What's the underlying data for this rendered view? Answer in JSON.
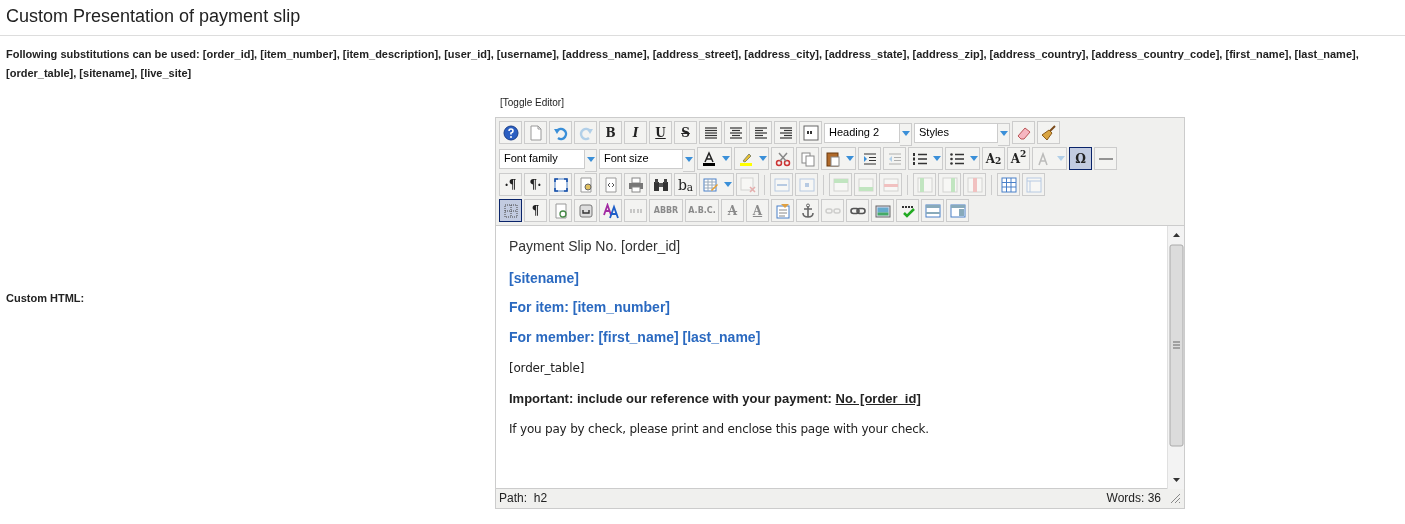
{
  "page_title": "Custom Presentation of payment slip",
  "substitutions": "Following substitutions can be used: [order_id], [item_number], [item_description], [user_id], [username], [address_name], [address_street], [address_city], [address_state], [address_zip], [address_country], [address_country_code], [first_name], [last_name], [order_table], [sitename], [live_site]",
  "field_label": "Custom HTML:",
  "toggle_editor": "[Toggle Editor]",
  "toolbar_rows": [
    [
      {
        "kind": "button",
        "disabled": false,
        "on": false
      },
      {
        "kind": "button",
        "disabled": false,
        "on": false
      },
      {
        "kind": "button",
        "disabled": false,
        "on": false
      },
      {
        "kind": "button",
        "disabled": true,
        "on": false
      },
      {
        "kind": "text",
        "label": "B",
        "disabled": false,
        "on": false
      },
      {
        "kind": "text",
        "label": "I",
        "disabled": false,
        "on": false
      },
      {
        "kind": "text",
        "label": "U",
        "disabled": false,
        "on": false
      },
      {
        "kind": "text",
        "label": "S",
        "disabled": false,
        "on": false
      },
      {
        "kind": "button",
        "disabled": false,
        "on": false
      },
      {
        "kind": "button",
        "disabled": false,
        "on": false
      },
      {
        "kind": "button",
        "disabled": false,
        "on": false
      },
      {
        "kind": "button",
        "disabled": false,
        "on": false
      },
      {
        "kind": "button",
        "disabled": false,
        "on": false
      },
      {
        "kind": "select",
        "value": "Heading 2"
      },
      {
        "kind": "select",
        "value": "Styles"
      },
      {
        "kind": "button",
        "disabled": false,
        "on": false
      },
      {
        "kind": "button",
        "disabled": false,
        "on": false
      }
    ],
    [
      {
        "kind": "select",
        "value": "Font family"
      },
      {
        "kind": "select",
        "value": "Font size"
      },
      {
        "kind": "split",
        "disabled": false
      },
      {
        "kind": "split",
        "disabled": false
      },
      {
        "kind": "button",
        "disabled": false,
        "on": false
      },
      {
        "kind": "button",
        "disabled": false,
        "on": false
      },
      {
        "kind": "split",
        "disabled": false
      },
      {
        "kind": "button",
        "disabled": false,
        "on": false
      },
      {
        "kind": "button",
        "disabled": true,
        "on": false
      },
      {
        "kind": "split",
        "disabled": false
      },
      {
        "kind": "split",
        "disabled": false
      },
      {
        "kind": "text",
        "label": "A$_{2}$",
        "disabled": false,
        "on": false
      },
      {
        "kind": "text",
        "label": "A$^{2}$",
        "disabled": false,
        "on": false
      },
      {
        "kind": "split",
        "disabled": true
      },
      {
        "kind": "text",
        "label": "Ω",
        "disabled": false,
        "on": true
      },
      {
        "kind": "button",
        "disabled": false,
        "on": false
      }
    ],
    [
      {
        "kind": "text",
        "label": "·¶",
        "disabled": false,
        "on": false
      },
      {
        "kind": "text",
        "label": "¶·",
        "disabled": false,
        "on": false
      },
      {
        "kind": "button",
        "disabled": false,
        "on": false
      },
      {
        "kind": "button",
        "disabled": false,
        "on": false
      },
      {
        "kind": "button",
        "disabled": false,
        "on": false
      },
      {
        "kind": "button",
        "disabled": false,
        "on": false
      },
      {
        "kind": "button",
        "disabled": false,
        "on": false
      },
      {
        "kind": "text",
        "label": "b$_{a}$",
        "disabled": false,
        "on": false
      },
      {
        "kind": "split",
        "disabled": false
      },
      {
        "kind": "button",
        "disabled": true,
        "on": false
      },
      {
        "kind": "separator"
      },
      {
        "kind": "button",
        "disabled": true,
        "on": false
      },
      {
        "kind": "button",
        "disabled": true,
        "on": false
      },
      {
        "kind": "separator"
      },
      {
        "kind": "button",
        "disabled": true,
        "on": false
      },
      {
        "kind": "button",
        "disabled": true,
        "on": false
      },
      {
        "kind": "button",
        "disabled": true,
        "on": false
      },
      {
        "kind": "separator"
      },
      {
        "kind": "button",
        "disabled": true,
        "on": false
      },
      {
        "kind": "button",
        "disabled": true,
        "on": false
      },
      {
        "kind": "button",
        "disabled": true,
        "on": false
      },
      {
        "kind": "separator"
      },
      {
        "kind": "button",
        "disabled": false,
        "on": false
      },
      {
        "kind": "button",
        "disabled": true,
        "on": false
      }
    ],
    [
      {
        "kind": "button",
        "disabled": false,
        "on": true
      },
      {
        "kind": "text",
        "label": "¶",
        "disabled": false,
        "on": false
      },
      {
        "kind": "button",
        "disabled": false,
        "on": false
      },
      {
        "kind": "button",
        "disabled": false,
        "on": false
      },
      {
        "kind": "button",
        "disabled": false,
        "on": false
      },
      {
        "kind": "button",
        "disabled": true,
        "on": false
      },
      {
        "kind": "text",
        "label": "ABBR",
        "disabled": true,
        "on": false
      },
      {
        "kind": "text",
        "label": "A.B.C.",
        "disabled": true,
        "on": false
      },
      {
        "kind": "text",
        "label": "A",
        "disabled": true,
        "on": false
      },
      {
        "kind": "text",
        "label": "A",
        "disabled": true,
        "on": false
      },
      {
        "kind": "button",
        "disabled": false,
        "on": false
      },
      {
        "kind": "button",
        "disabled": false,
        "on": false
      },
      {
        "kind": "button",
        "disabled": true,
        "on": false
      },
      {
        "kind": "button",
        "disabled": false,
        "on": false
      },
      {
        "kind": "button",
        "disabled": false,
        "on": false
      },
      {
        "kind": "button",
        "disabled": false
      },
      {
        "kind": "button",
        "disabled": false,
        "on": false
      },
      {
        "kind": "button",
        "disabled": false,
        "on": false
      }
    ]
  ],
  "content": [
    {
      "kind": "p",
      "text": "Payment Slip No. [order_id]"
    },
    {
      "kind": "h2",
      "text": "[sitename]"
    },
    {
      "kind": "h2",
      "text": "For item: [item_number]"
    },
    {
      "kind": "h2",
      "text": "For member: [first_name] [last_name]"
    },
    {
      "kind": "small",
      "text": "[order_table]"
    },
    {
      "kind": "important",
      "text": "Important: include our reference with your payment: ",
      "underlined": "No. [order_id]"
    },
    {
      "kind": "small",
      "text": "If you pay by check, please print and enclose this page with your check."
    }
  ],
  "status_bar": {
    "path_label": "Path:",
    "path": "h2",
    "words": "Words: 36"
  }
}
